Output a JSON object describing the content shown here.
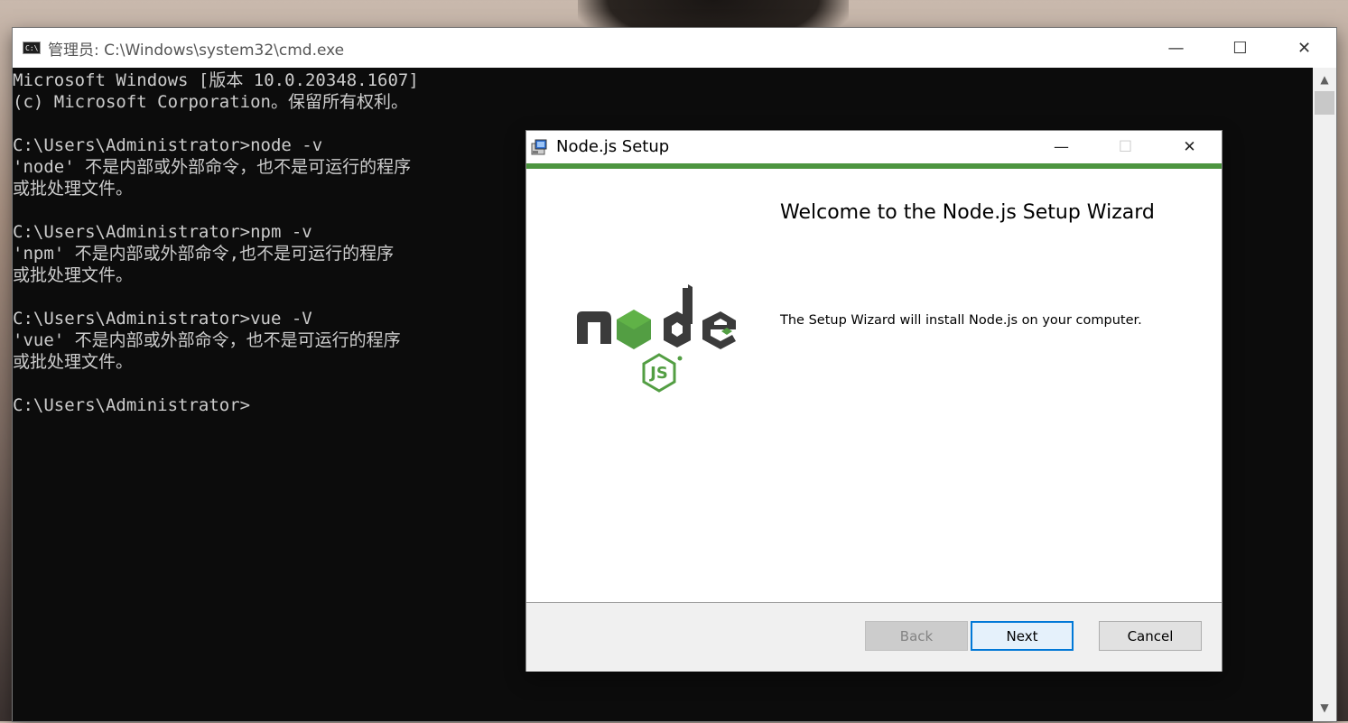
{
  "cmd": {
    "title": "管理员: C:\\Windows\\system32\\cmd.exe",
    "icon_text": "C:\\",
    "controls": {
      "minimize": "—",
      "maximize": "☐",
      "close": "✕"
    },
    "lines": [
      "Microsoft Windows [版本 10.0.20348.1607]",
      "(c) Microsoft Corporation。保留所有权利。",
      "",
      "C:\\Users\\Administrator>node -v",
      "'node' 不是内部或外部命令，也不是可运行的程序",
      "或批处理文件。",
      "",
      "C:\\Users\\Administrator>npm -v",
      "'npm' 不是内部或外部命令,也不是可运行的程序",
      "或批处理文件。",
      "",
      "C:\\Users\\Administrator>vue -V",
      "'vue' 不是内部或外部命令，也不是可运行的程序",
      "或批处理文件。",
      "",
      "C:\\Users\\Administrator>"
    ],
    "scroll": {
      "up": "▲",
      "down": "▼"
    }
  },
  "setup": {
    "title": "Node.js Setup",
    "controls": {
      "minimize": "—",
      "maximize": "☐",
      "close": "✕"
    },
    "welcome_title": "Welcome to the Node.js Setup Wizard",
    "welcome_desc": "The Setup Wizard will install Node.js on your computer.",
    "buttons": {
      "back": "Back",
      "next": "Next",
      "cancel": "Cancel"
    },
    "accent_color": "#4d9540"
  }
}
